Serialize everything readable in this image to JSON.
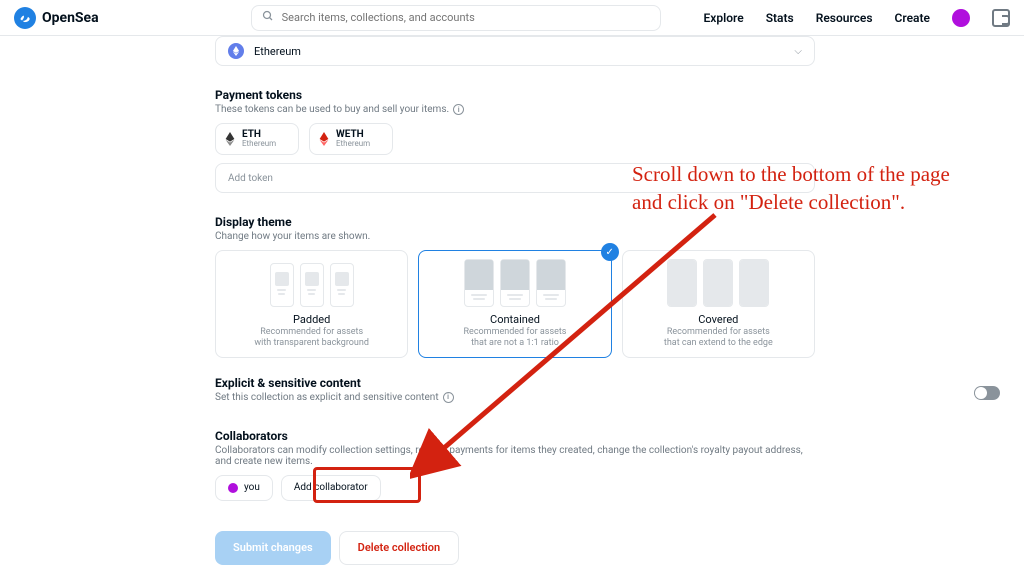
{
  "header": {
    "brand": "OpenSea",
    "search_placeholder": "Search items, collections, and accounts",
    "nav": {
      "explore": "Explore",
      "stats": "Stats",
      "resources": "Resources",
      "create": "Create"
    }
  },
  "blockchain": {
    "label": "Ethereum"
  },
  "payment": {
    "title": "Payment tokens",
    "sub": "These tokens can be used to buy and sell your items.",
    "tokens": [
      {
        "symbol": "ETH",
        "network": "Ethereum"
      },
      {
        "symbol": "WETH",
        "network": "Ethereum"
      }
    ],
    "add_placeholder": "Add token"
  },
  "theme": {
    "title": "Display theme",
    "sub": "Change how your items are shown.",
    "options": [
      {
        "name": "Padded",
        "desc1": "Recommended for assets",
        "desc2": "with transparent background"
      },
      {
        "name": "Contained",
        "desc1": "Recommended for assets",
        "desc2": "that are not a 1:1 ratio"
      },
      {
        "name": "Covered",
        "desc1": "Recommended for assets",
        "desc2": "that can extend to the edge"
      }
    ]
  },
  "explicit": {
    "title": "Explicit & sensitive content",
    "sub": "Set this collection as explicit and sensitive content"
  },
  "collab": {
    "title": "Collaborators",
    "sub": "Collaborators can modify collection settings, receive payments for items they created, change the collection's royalty payout address, and create new items.",
    "you": "you",
    "add": "Add collaborator"
  },
  "actions": {
    "submit": "Submit changes",
    "delete": "Delete collection"
  },
  "callout": {
    "text": "Scroll down to the bottom of the page and click on \"Delete collection\"."
  }
}
